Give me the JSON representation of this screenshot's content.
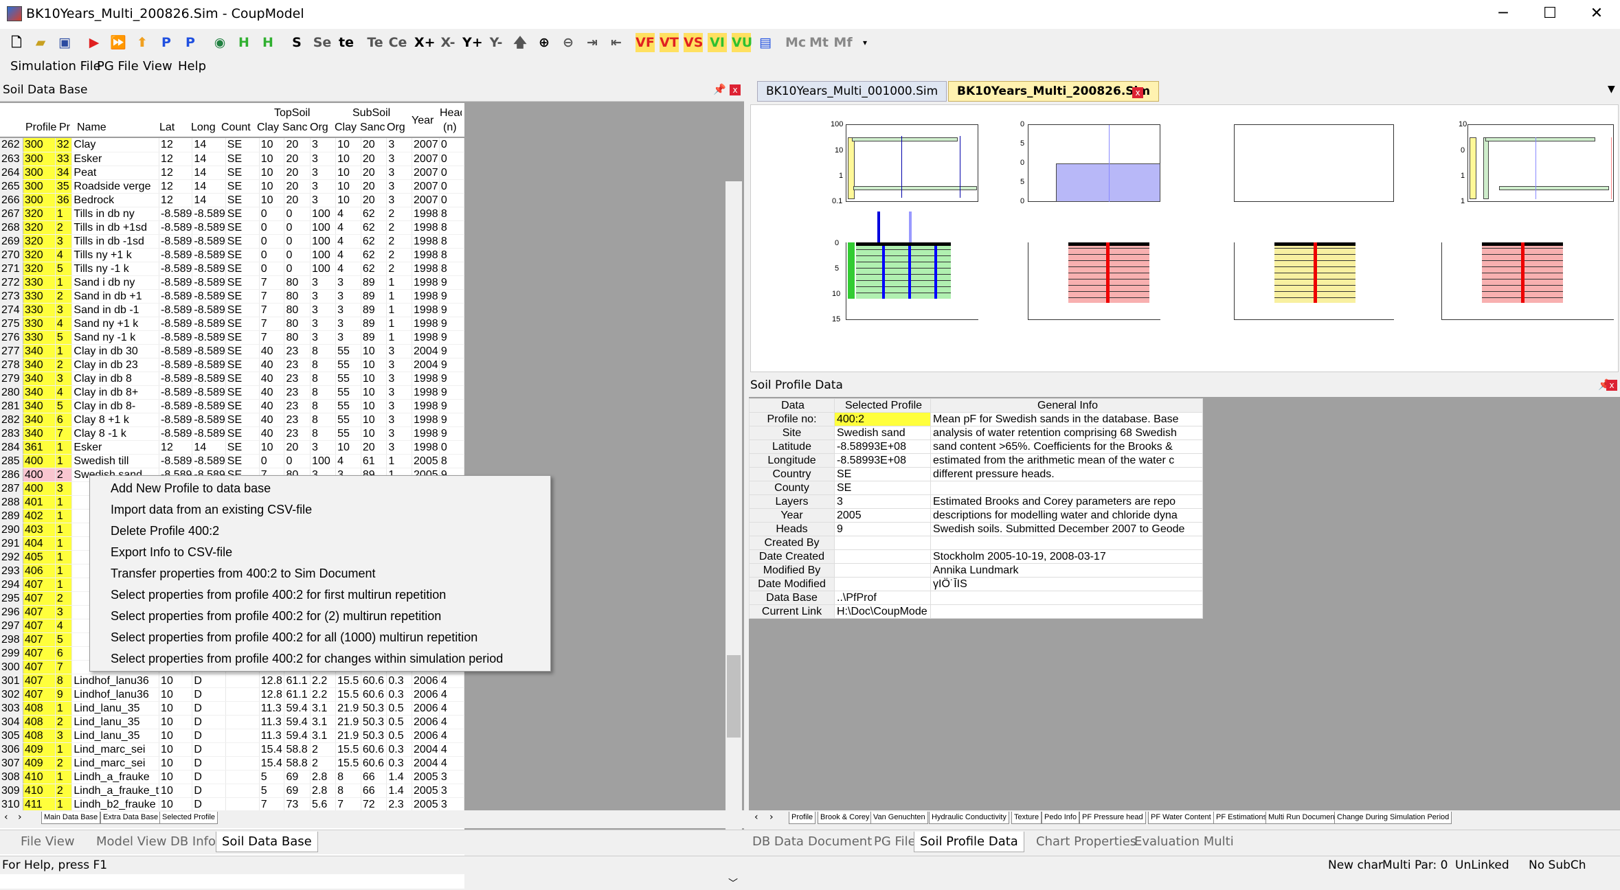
{
  "window": {
    "title": "BK10Years_Multi_200826.Sim - CoupModel",
    "minimize": "─",
    "maximize": "☐",
    "close": "✕"
  },
  "toolbar": {
    "buttons": [
      "S",
      "Se",
      "te",
      "Te",
      "Ce",
      "X+",
      "X-",
      "Y+",
      "Y-",
      "VF",
      "VT",
      "VS",
      "VI",
      "VU",
      "Mc",
      "Mt",
      "Mf"
    ]
  },
  "menu": [
    "Simulation File",
    "PG File",
    "View",
    "Help"
  ],
  "left_panel": {
    "title": "Soil Data Base",
    "pin": "📌",
    "close": "x"
  },
  "grid": {
    "headers": {
      "profile": "Profile",
      "pr": "Pr",
      "name": "Name",
      "lat": "Lat",
      "long": "Long",
      "count": "Count",
      "topsoil": "TopSoil",
      "subsoil": "SubSoil",
      "clay1": "Clay",
      "sand1": "Sanc",
      "org1": "Org",
      "clay2": "Clay",
      "sand2": "Sanc",
      "org2": "Org",
      "year": "Year",
      "head": "Head",
      "n": "(n)"
    },
    "rows": [
      [
        "262",
        "300",
        "32",
        "Clay",
        "12",
        "14",
        "SE",
        "10",
        "20",
        "3",
        "10",
        "20",
        "3",
        "2007",
        "0"
      ],
      [
        "263",
        "300",
        "33",
        "Esker",
        "12",
        "14",
        "SE",
        "10",
        "20",
        "3",
        "10",
        "20",
        "3",
        "2007",
        "0"
      ],
      [
        "264",
        "300",
        "34",
        "Peat",
        "12",
        "14",
        "SE",
        "10",
        "20",
        "3",
        "10",
        "20",
        "3",
        "2007",
        "0"
      ],
      [
        "265",
        "300",
        "35",
        "Roadside verge",
        "12",
        "14",
        "SE",
        "10",
        "20",
        "3",
        "10",
        "20",
        "3",
        "2007",
        "0"
      ],
      [
        "266",
        "300",
        "36",
        "Bedrock",
        "12",
        "14",
        "SE",
        "10",
        "20",
        "3",
        "10",
        "20",
        "3",
        "2007",
        "0"
      ],
      [
        "267",
        "320",
        "1",
        "Tills in db ny",
        "-8.589",
        "-8.589",
        "SE",
        "0",
        "0",
        "100",
        "4",
        "62",
        "2",
        "1998",
        "8"
      ],
      [
        "268",
        "320",
        "2",
        "Tills in db +1sd",
        "-8.589",
        "-8.589",
        "SE",
        "0",
        "0",
        "100",
        "4",
        "62",
        "2",
        "1998",
        "8"
      ],
      [
        "269",
        "320",
        "3",
        "Tills in db -1sd",
        "-8.589",
        "-8.589",
        "SE",
        "0",
        "0",
        "100",
        "4",
        "62",
        "2",
        "1998",
        "8"
      ],
      [
        "270",
        "320",
        "4",
        "Tills ny +1 k",
        "-8.589",
        "-8.589",
        "SE",
        "0",
        "0",
        "100",
        "4",
        "62",
        "2",
        "1998",
        "8"
      ],
      [
        "271",
        "320",
        "5",
        "Tills ny -1 k",
        "-8.589",
        "-8.589",
        "SE",
        "0",
        "0",
        "100",
        "4",
        "62",
        "2",
        "1998",
        "8"
      ],
      [
        "272",
        "330",
        "1",
        "Sand i db ny",
        "-8.589",
        "-8.589",
        "SE",
        "7",
        "80",
        "3",
        "3",
        "89",
        "1",
        "1998",
        "9"
      ],
      [
        "273",
        "330",
        "2",
        "Sand in db +1",
        "-8.589",
        "-8.589",
        "SE",
        "7",
        "80",
        "3",
        "3",
        "89",
        "1",
        "1998",
        "9"
      ],
      [
        "274",
        "330",
        "3",
        "Sand in db -1",
        "-8.589",
        "-8.589",
        "SE",
        "7",
        "80",
        "3",
        "3",
        "89",
        "1",
        "1998",
        "9"
      ],
      [
        "275",
        "330",
        "4",
        "Sand ny +1 k",
        "-8.589",
        "-8.589",
        "SE",
        "7",
        "80",
        "3",
        "3",
        "89",
        "1",
        "1998",
        "9"
      ],
      [
        "276",
        "330",
        "5",
        "Sand ny -1 k",
        "-8.589",
        "-8.589",
        "SE",
        "7",
        "80",
        "3",
        "3",
        "89",
        "1",
        "1998",
        "9"
      ],
      [
        "277",
        "340",
        "1",
        "Clay in db 30",
        "-8.589",
        "-8.589",
        "SE",
        "40",
        "23",
        "8",
        "55",
        "10",
        "3",
        "2004",
        "9"
      ],
      [
        "278",
        "340",
        "2",
        "Clay in db 23",
        "-8.589",
        "-8.589",
        "SE",
        "40",
        "23",
        "8",
        "55",
        "10",
        "3",
        "2004",
        "9"
      ],
      [
        "279",
        "340",
        "3",
        "Clay in db 8",
        "-8.589",
        "-8.589",
        "SE",
        "40",
        "23",
        "8",
        "55",
        "10",
        "3",
        "1998",
        "9"
      ],
      [
        "280",
        "340",
        "4",
        "Clay in db 8+",
        "-8.589",
        "-8.589",
        "SE",
        "40",
        "23",
        "8",
        "55",
        "10",
        "3",
        "1998",
        "9"
      ],
      [
        "281",
        "340",
        "5",
        "Clay in db 8-",
        "-8.589",
        "-8.589",
        "SE",
        "40",
        "23",
        "8",
        "55",
        "10",
        "3",
        "1998",
        "9"
      ],
      [
        "282",
        "340",
        "6",
        "Clay 8 +1 k",
        "-8.589",
        "-8.589",
        "SE",
        "40",
        "23",
        "8",
        "55",
        "10",
        "3",
        "1998",
        "9"
      ],
      [
        "283",
        "340",
        "7",
        "Clay 8 -1 k",
        "-8.589",
        "-8.589",
        "SE",
        "40",
        "23",
        "8",
        "55",
        "10",
        "3",
        "1998",
        "9"
      ],
      [
        "284",
        "361",
        "1",
        "Esker",
        "12",
        "14",
        "SE",
        "10",
        "20",
        "3",
        "10",
        "20",
        "3",
        "1998",
        "0"
      ],
      [
        "285",
        "400",
        "1",
        "Swedish till",
        "-8.589",
        "-8.589",
        "SE",
        "0",
        "0",
        "100",
        "4",
        "61",
        "1",
        "2005",
        "8"
      ],
      [
        "286",
        "400",
        "2",
        "Swedish sand",
        "-8.589",
        "-8.589",
        "SE",
        "7",
        "80",
        "3",
        "3",
        "89",
        "1",
        "2005",
        "9"
      ],
      [
        "287",
        "400",
        "3",
        "",
        "",
        "",
        "",
        "",
        "",
        "",
        "",
        "",
        "",
        "",
        ""
      ],
      [
        "288",
        "401",
        "1",
        "",
        "",
        "",
        "",
        "",
        "",
        "",
        "",
        "",
        "",
        "",
        ""
      ],
      [
        "289",
        "402",
        "1",
        "",
        "",
        "",
        "",
        "",
        "",
        "",
        "",
        "",
        "",
        "",
        ""
      ],
      [
        "290",
        "403",
        "1",
        "",
        "",
        "",
        "",
        "",
        "",
        "",
        "",
        "",
        "",
        "",
        ""
      ],
      [
        "291",
        "404",
        "1",
        "",
        "",
        "",
        "",
        "",
        "",
        "",
        "",
        "",
        "",
        "",
        ""
      ],
      [
        "292",
        "405",
        "1",
        "",
        "",
        "",
        "",
        "",
        "",
        "",
        "",
        "",
        "",
        "",
        ""
      ],
      [
        "293",
        "406",
        "1",
        "",
        "",
        "",
        "",
        "",
        "",
        "",
        "",
        "",
        "",
        "",
        ""
      ],
      [
        "294",
        "407",
        "1",
        "",
        "",
        "",
        "",
        "",
        "",
        "",
        "",
        "",
        "",
        "",
        ""
      ],
      [
        "295",
        "407",
        "2",
        "",
        "",
        "",
        "",
        "",
        "",
        "",
        "",
        "",
        "",
        "",
        ""
      ],
      [
        "296",
        "407",
        "3",
        "",
        "",
        "",
        "",
        "",
        "",
        "",
        "",
        "",
        "",
        "",
        ""
      ],
      [
        "297",
        "407",
        "4",
        "",
        "",
        "",
        "",
        "",
        "",
        "",
        "",
        "",
        "",
        "",
        ""
      ],
      [
        "298",
        "407",
        "5",
        "",
        "",
        "",
        "",
        "",
        "",
        "",
        "",
        "",
        "",
        "",
        ""
      ],
      [
        "299",
        "407",
        "6",
        "",
        "",
        "",
        "",
        "",
        "",
        "",
        "",
        "",
        "",
        "",
        ""
      ],
      [
        "300",
        "407",
        "7",
        "",
        "",
        "",
        "",
        "",
        "",
        "",
        "",
        "",
        "",
        "",
        ""
      ],
      [
        "301",
        "407",
        "8",
        "Lindhof_lanu36",
        "10",
        "D",
        "",
        "12.8",
        "61.1",
        "2.2",
        "15.5",
        "60.6",
        "0.3",
        "2006",
        "4"
      ],
      [
        "302",
        "407",
        "9",
        "Lindhof_lanu36",
        "10",
        "D",
        "",
        "12.8",
        "61.1",
        "2.2",
        "15.5",
        "60.6",
        "0.3",
        "2006",
        "4"
      ],
      [
        "303",
        "408",
        "1",
        "Lind_lanu_35",
        "10",
        "D",
        "",
        "11.3",
        "59.4",
        "3.1",
        "21.9",
        "50.3",
        "0.5",
        "2006",
        "4"
      ],
      [
        "304",
        "408",
        "2",
        "Lind_lanu_35",
        "10",
        "D",
        "",
        "11.3",
        "59.4",
        "3.1",
        "21.9",
        "50.3",
        "0.5",
        "2006",
        "4"
      ],
      [
        "305",
        "408",
        "3",
        "Lind_lanu_35",
        "10",
        "D",
        "",
        "11.3",
        "59.4",
        "3.1",
        "21.9",
        "50.3",
        "0.5",
        "2006",
        "4"
      ],
      [
        "306",
        "409",
        "1",
        "Lind_marc_sei",
        "10",
        "D",
        "",
        "15.4",
        "58.8",
        "2",
        "15.5",
        "60.6",
        "0.3",
        "2004",
        "4"
      ],
      [
        "307",
        "409",
        "2",
        "Lind_marc_sei",
        "10",
        "D",
        "",
        "15.4",
        "58.8",
        "2",
        "15.5",
        "60.6",
        "0.3",
        "2004",
        "4"
      ],
      [
        "308",
        "410",
        "1",
        "Lindh_a_frauke",
        "10",
        "D",
        "",
        "5",
        "69",
        "2.8",
        "8",
        "66",
        "1.4",
        "2005",
        "3"
      ],
      [
        "309",
        "410",
        "2",
        "Lindh_a_frauke_t",
        "10",
        "D",
        "",
        "5",
        "69",
        "2.8",
        "8",
        "66",
        "1.4",
        "2005",
        "3"
      ],
      [
        "310",
        "411",
        "1",
        "Lindh_b2_frauke",
        "10",
        "D",
        "",
        "7",
        "73",
        "5.6",
        "7",
        "72",
        "2.3",
        "2005",
        "3"
      ]
    ]
  },
  "left_sheet_tabs": [
    "Main Data Base",
    "Extra Data Base",
    "Selected Profile"
  ],
  "context_menu": [
    "Add New Profile to data base",
    "Import data from an existing CSV-file",
    "Delete Profile 400:2",
    "Export Info to CSV-file",
    "Transfer properties from 400:2 to Sim Document",
    "Select properties from profile 400:2 for first multirun repetition",
    "Select properties from profile 400:2 for (2) multirun repetition",
    "Select properties from profile 400:2 for all (1000) multirun repetition",
    "Select properties from profile 400:2 for changes within simulation period"
  ],
  "doc_tabs": [
    "BK10Years_Multi_001000.Sim",
    "BK10Years_Multi_200826.Sim"
  ],
  "plots": {
    "p1_ticks": [
      "100",
      "10",
      "1",
      "0.1"
    ],
    "p2_ticks": [
      "0",
      "5",
      "0",
      "5",
      "0"
    ],
    "p4_ticks": [
      "10",
      "0",
      "1",
      "1"
    ],
    "depth_ticks": [
      "0",
      "5",
      "10",
      "15"
    ]
  },
  "soil_profile": {
    "title": "Soil Profile Data",
    "col_headers": [
      "Data",
      "Selected Profile",
      "General Info"
    ],
    "rows": [
      [
        "Profile no:",
        "400:2",
        "Mean pF for Swedish sands in the database. Base"
      ],
      [
        "Site",
        "Swedish sand",
        "analysis of water retention comprising 68 Swedish"
      ],
      [
        "Latitude",
        "-8.58993E+08",
        "sand content >65%. Coefficients for the Brooks &"
      ],
      [
        "Longitude",
        "-8.58993E+08",
        "estimated from the arithmetic mean of the water c"
      ],
      [
        "Country",
        "SE",
        "different pressure heads."
      ],
      [
        "County",
        "SE",
        ""
      ],
      [
        "Layers",
        "3",
        "Estimated Brooks and Corey parameters are repo"
      ],
      [
        "Year",
        "2005",
        "descriptions for modelling water and chloride dyna"
      ],
      [
        "Heads",
        "9",
        "Swedish soils. Submitted December 2007 to Geode"
      ],
      [
        "Created By",
        "",
        ""
      ],
      [
        "Date Created",
        "",
        "Stockholm 2005-10-19, 2008-03-17"
      ],
      [
        "Modified By",
        "",
        "Annika Lundmark"
      ],
      [
        "Date Modified",
        "",
        "γIÖ˙ĪIS"
      ],
      [
        "Data Base",
        "..\\PfProf",
        ""
      ],
      [
        "Current Link",
        "H:\\Doc\\CoupMode",
        ""
      ]
    ]
  },
  "right_sheet_tabs": [
    "Profile",
    "Brook & Corey",
    "Van Genuchten",
    "Hydraulic Conductivity",
    "Texture",
    "Pedo Info",
    "PF Pressure head",
    "PF Water Content",
    "PF Estimations",
    "Multi Run Document",
    "Change During Simulation Period"
  ],
  "left_view_tabs": [
    "File View",
    "Model View",
    "DB Info",
    "Soil Data Base"
  ],
  "right_view_tabs": [
    "DB Data",
    "Document",
    "PG File",
    "Soil Profile Data",
    "Chart Properties",
    "Evaluation Multi"
  ],
  "status": {
    "help": "For Help, press F1",
    "s1": "New char",
    "s2": "Multi Par: 0",
    "s3": "UnLinked",
    "s4": "No SubCh"
  },
  "colors": {
    "yellow": "#ffff3c",
    "pink": "#f9c6d0",
    "active_tab": "#fff2b0"
  }
}
